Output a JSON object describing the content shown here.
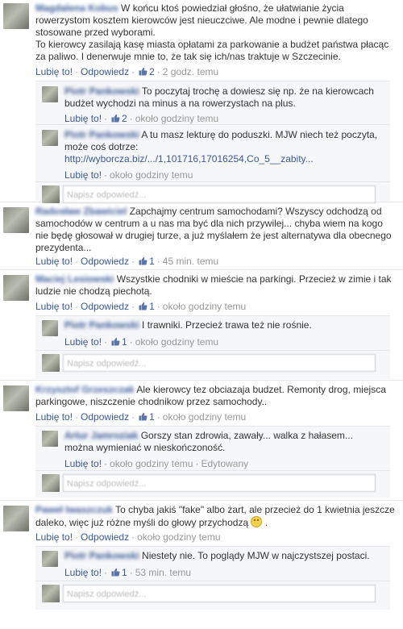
{
  "ui": {
    "like": "Lubię to!",
    "reply": "Odpowiedz",
    "edited": "Edytowany",
    "reply_placeholder": "Napisz odpowiedź..."
  },
  "colors": {
    "link": "#3b5998",
    "reply_bg": "#f6f7f8",
    "muted": "#999999"
  },
  "comments": [
    {
      "author": "Magdalena Kobus",
      "text": "W końcu ktoś powiedział głośno, że ułatwianie życia rowerzystom kosztem kierowców jest nieuczciwe. Ale modne i pewnie dlatego stosowane przed wyborami.",
      "text2": "To kierowcy zasilają kasę miasta opłatami za parkowanie a budżet państwa płacąc za paliwo. I denerwuje mnie to, że tak się ich/nas traktuje w Szczecinie.",
      "likes": "2",
      "time": "2 godz. temu",
      "replies": [
        {
          "author": "Piotr Pankowski",
          "text": "To poczytaj trochę a dowiesz się np. że na kierowcach budżet wychodzi na minus a na rowerzystach na plus.",
          "likes": "2",
          "time": "około godziny temu"
        },
        {
          "author": "Piotr Pankowski",
          "text": "A tu masz lekturę do poduszki. MJW niech też poczyta, może coś dotrze:",
          "link": "http://wyborcza.biz/.../1,101716,17016254,Co_5__zabity...",
          "time": "około godziny temu"
        }
      ]
    },
    {
      "author": "Radosław Zbawiciel",
      "text": "Zapchajmy centrum samochodami? Wszyscy odchodzą od samochodów w centrum a u nas ma być dla nich przywilej... chyba wiem na kogo nie będę głosował w drugiej turze, a już myślałem że jest alternatywa dla obecnego prezydenta...",
      "likes": "1",
      "time": "45 min. temu"
    },
    {
      "author": "Maciej Lesiowski",
      "text": "Wszystkie chodniki w mieście na parkingi. Przecież w zimie i tak ludzie nie chodzą piechotą.",
      "likes": "1",
      "time": "około godziny temu",
      "replies": [
        {
          "author": "Piotr Pankowski",
          "text": "I trawniki. Przecież trawa też nie rośnie.",
          "likes": "1",
          "time": "około godziny temu"
        }
      ]
    },
    {
      "author": "Krzysztof Grzeszczak",
      "text": "Ale kierowcy tez obciazaja budzet. Remonty drog, miejsca parkingowe, niszczenie chodnikow przez samochody..",
      "likes": "1",
      "time": "około godziny temu",
      "replies": [
        {
          "author": "Artur Jamroziak",
          "text": "Gorszy stan zdrowia, zawały... walka z hałasem... można wymieniać w nieskończoność.",
          "time": "około godziny temu"
        }
      ]
    },
    {
      "author": "Paweł Iwaszczuk",
      "text": "To chyba jakiś \"fake\" albo żart, ale przecież do 1 kwietnia jeszcze daleko, więc już różne myśli do głowy przychodzą",
      "text_end": ".",
      "time": "około godziny temu",
      "replies": [
        {
          "author": "Piotr Pankowski",
          "text": "Niestety nie. To poglądy MJW w najczystszej postaci.",
          "likes": "1",
          "time": "53 min. temu"
        }
      ]
    }
  ]
}
